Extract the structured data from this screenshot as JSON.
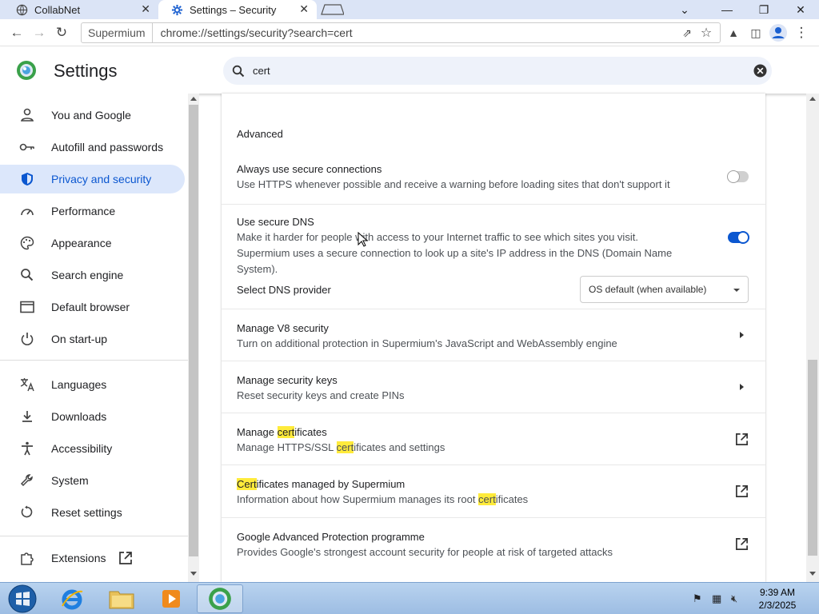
{
  "tabs": [
    {
      "label": "CollabNet",
      "active": false
    },
    {
      "label": "Settings – Security",
      "active": true
    }
  ],
  "toolbar": {
    "brand": "Supermium",
    "url": "chrome://settings/security?search=cert"
  },
  "header": {
    "title": "Settings",
    "search_value": "cert"
  },
  "sidebar": {
    "items": [
      {
        "label": "You and Google",
        "icon": "person-icon"
      },
      {
        "label": "Autofill and passwords",
        "icon": "key-icon"
      },
      {
        "label": "Privacy and security",
        "icon": "shield-icon",
        "active": true
      },
      {
        "label": "Performance",
        "icon": "speedometer-icon"
      },
      {
        "label": "Appearance",
        "icon": "palette-icon"
      },
      {
        "label": "Search engine",
        "icon": "search-icon"
      },
      {
        "label": "Default browser",
        "icon": "browser-window-icon"
      },
      {
        "label": "On start-up",
        "icon": "power-icon"
      },
      {
        "label": "Languages",
        "icon": "translate-icon"
      },
      {
        "label": "Downloads",
        "icon": "download-icon"
      },
      {
        "label": "Accessibility",
        "icon": "accessibility-icon"
      },
      {
        "label": "System",
        "icon": "wrench-icon"
      },
      {
        "label": "Reset settings",
        "icon": "reset-icon"
      },
      {
        "label": "Extensions",
        "icon": "puzzle-icon"
      }
    ]
  },
  "main": {
    "section_title": "Advanced",
    "https": {
      "title": "Always use secure connections",
      "subtitle": "Use HTTPS whenever possible and receive a warning before loading sites that don't support it",
      "enabled": false
    },
    "dns": {
      "title": "Use secure DNS",
      "subtitle": "Make it harder for people with access to your Internet traffic to see which sites you visit. Supermium uses a secure connection to look up a site's IP address in the DNS (Domain Name System).",
      "enabled": true,
      "provider_label": "Select DNS provider",
      "provider_value": "OS default (when available)"
    },
    "v8": {
      "title": "Manage V8 security",
      "subtitle": "Turn on additional protection in Supermium's JavaScript and WebAssembly engine"
    },
    "keys": {
      "title": "Manage security keys",
      "subtitle": "Reset security keys and create PINs"
    },
    "certs": {
      "title_pre": "Manage ",
      "title_hl": "cert",
      "title_post": "ificates",
      "sub_pre": "Manage HTTPS/SSL ",
      "sub_hl": "cert",
      "sub_post": "ificates and settings"
    },
    "managed": {
      "title_hl": "Cert",
      "title_post": "ificates managed by Supermium",
      "sub_pre": "Information about how Supermium manages its root ",
      "sub_hl": "cert",
      "sub_post": "ificates"
    },
    "gap": {
      "title": "Google Advanced Protection programme",
      "subtitle": "Provides Google's strongest account security for people at risk of targeted attacks"
    }
  },
  "taskbar": {
    "time": "9:39 AM",
    "date": "2/3/2025"
  },
  "colors": {
    "accent": "#0b57d0",
    "highlight": "#ffeb3b",
    "active_nav_bg": "#dce7fb"
  }
}
